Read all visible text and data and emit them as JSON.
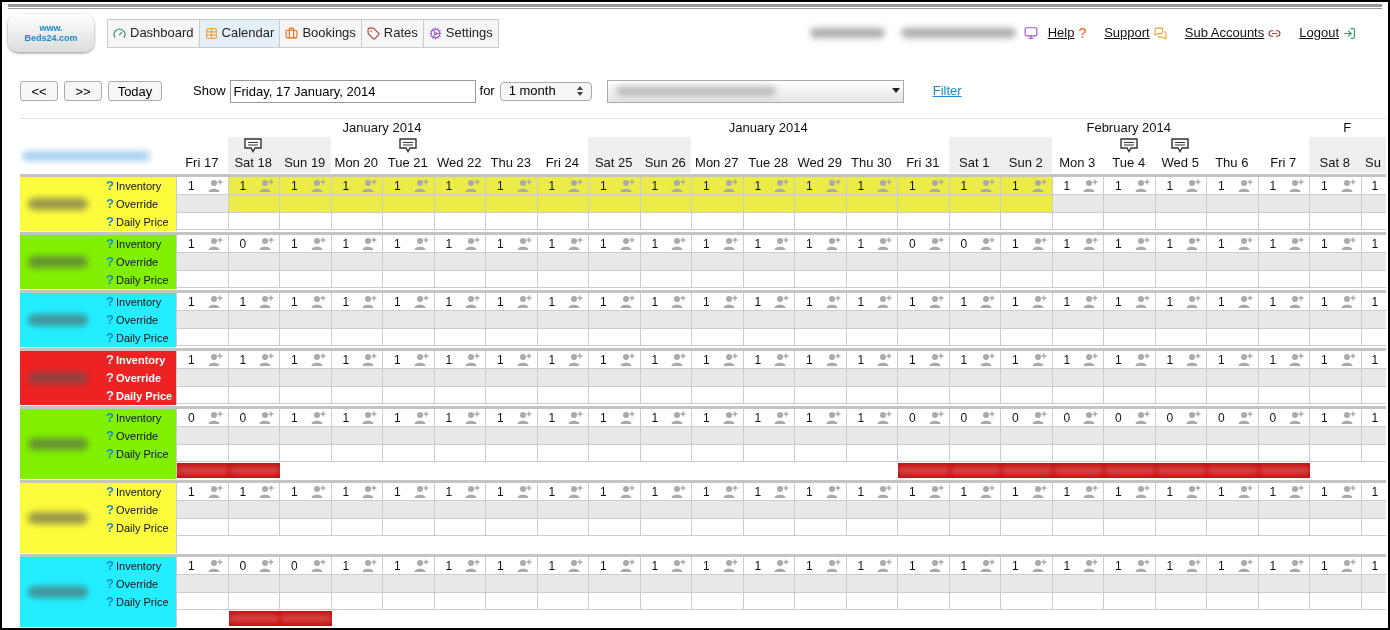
{
  "logo": {
    "line1": "www.",
    "line2": "Beds24.com"
  },
  "nav": [
    {
      "label": "Dashboard",
      "kind": "dashboard",
      "selected": false
    },
    {
      "label": "Calendar",
      "kind": "calendar",
      "selected": true
    },
    {
      "label": "Bookings",
      "kind": "bookings",
      "selected": false
    },
    {
      "label": "Rates",
      "kind": "rates",
      "selected": false
    },
    {
      "label": "Settings",
      "kind": "settings",
      "selected": false
    }
  ],
  "top_links": [
    {
      "label": "Help",
      "kind": "help",
      "mark": "?"
    },
    {
      "label": "Support",
      "kind": "support"
    },
    {
      "label": "Sub Accounts",
      "kind": "accounts"
    },
    {
      "label": "Logout",
      "kind": "logout"
    }
  ],
  "controls": {
    "prev": "<<",
    "next": ">>",
    "today": "Today",
    "show_label": "Show",
    "date": "Friday, 17 January, 2014",
    "for_label": "for",
    "period": "1 month",
    "filter": "Filter"
  },
  "months": [
    {
      "label": "January 2014",
      "days": [
        {
          "label": "Fri 17",
          "weekend": false,
          "comment": false
        },
        {
          "label": "Sat 18",
          "weekend": true,
          "comment": true
        },
        {
          "label": "Sun 19",
          "weekend": true,
          "comment": false
        },
        {
          "label": "Mon 20",
          "weekend": false,
          "comment": false
        },
        {
          "label": "Tue 21",
          "weekend": false,
          "comment": true
        },
        {
          "label": "Wed 22",
          "weekend": false,
          "comment": false
        },
        {
          "label": "Thu 23",
          "weekend": false,
          "comment": false
        },
        {
          "label": "Fri 24",
          "weekend": false,
          "comment": false
        }
      ]
    },
    {
      "label": "January 2014",
      "days": [
        {
          "label": "Sat 25",
          "weekend": true,
          "comment": false
        },
        {
          "label": "Sun 26",
          "weekend": true,
          "comment": false
        },
        {
          "label": "Mon 27",
          "weekend": false,
          "comment": false
        },
        {
          "label": "Tue 28",
          "weekend": false,
          "comment": false
        },
        {
          "label": "Wed 29",
          "weekend": false,
          "comment": false
        },
        {
          "label": "Thu 30",
          "weekend": false,
          "comment": false
        },
        {
          "label": "Fri 31",
          "weekend": false,
          "comment": false
        }
      ]
    },
    {
      "label": "February 2014",
      "days": [
        {
          "label": "Sat 1",
          "weekend": true,
          "comment": false
        },
        {
          "label": "Sun 2",
          "weekend": true,
          "comment": false
        },
        {
          "label": "Mon 3",
          "weekend": false,
          "comment": false
        },
        {
          "label": "Tue 4",
          "weekend": false,
          "comment": true
        },
        {
          "label": "Wed 5",
          "weekend": false,
          "comment": true
        },
        {
          "label": "Thu 6",
          "weekend": false,
          "comment": false
        },
        {
          "label": "Fri 7",
          "weekend": false,
          "comment": false
        }
      ]
    },
    {
      "label": "F",
      "days": [
        {
          "label": "Sat 8",
          "weekend": true,
          "comment": false
        },
        {
          "label": "Su",
          "weekend": true,
          "comment": false,
          "partial": true
        }
      ]
    }
  ],
  "rooms": [
    {
      "color": "#fcfc3c",
      "light_text": false,
      "labels": [
        {
          "mark": "?",
          "text": "Inventory"
        },
        {
          "mark": "?",
          "text": "Override"
        },
        {
          "mark": "?",
          "text": "Daily Price"
        }
      ],
      "cells": [
        {
          "value": "1",
          "selected": false
        },
        {
          "value": "1",
          "selected": true
        },
        {
          "value": "1",
          "selected": true
        },
        {
          "value": "1",
          "selected": true
        },
        {
          "value": "1",
          "selected": true
        },
        {
          "value": "1",
          "selected": true
        },
        {
          "value": "1",
          "selected": true
        },
        {
          "value": "1",
          "selected": true
        },
        {
          "value": "1",
          "selected": true
        },
        {
          "value": "1",
          "selected": true
        },
        {
          "value": "1",
          "selected": true
        },
        {
          "value": "1",
          "selected": true
        },
        {
          "value": "1",
          "selected": true
        },
        {
          "value": "1",
          "selected": true
        },
        {
          "value": "1",
          "selected": true
        },
        {
          "value": "1",
          "selected": true
        },
        {
          "value": "1",
          "selected": true
        },
        {
          "value": "1",
          "selected": false
        },
        {
          "value": "1",
          "selected": false
        },
        {
          "value": "1",
          "selected": false
        },
        {
          "value": "1",
          "selected": false
        },
        {
          "value": "1",
          "selected": false
        },
        {
          "value": "1",
          "selected": false
        },
        {
          "value": "1",
          "selected": false
        }
      ]
    },
    {
      "color": "#80f000",
      "light_text": false,
      "labels": [
        {
          "mark": "?",
          "text": "Inventory"
        },
        {
          "mark": "?",
          "text": "Override"
        },
        {
          "mark": "?",
          "text": "Daily Price"
        }
      ],
      "cells": [
        {
          "value": "1",
          "selected": false
        },
        {
          "value": "0",
          "selected": false
        },
        {
          "value": "1",
          "selected": false
        },
        {
          "value": "1",
          "selected": false
        },
        {
          "value": "1",
          "selected": false
        },
        {
          "value": "1",
          "selected": false
        },
        {
          "value": "1",
          "selected": false
        },
        {
          "value": "1",
          "selected": false
        },
        {
          "value": "1",
          "selected": false
        },
        {
          "value": "1",
          "selected": false
        },
        {
          "value": "1",
          "selected": false
        },
        {
          "value": "1",
          "selected": false
        },
        {
          "value": "1",
          "selected": false
        },
        {
          "value": "1",
          "selected": false
        },
        {
          "value": "0",
          "selected": false
        },
        {
          "value": "0",
          "selected": false
        },
        {
          "value": "1",
          "selected": false
        },
        {
          "value": "1",
          "selected": false
        },
        {
          "value": "1",
          "selected": false
        },
        {
          "value": "1",
          "selected": false
        },
        {
          "value": "1",
          "selected": false
        },
        {
          "value": "1",
          "selected": false
        },
        {
          "value": "1",
          "selected": false
        },
        {
          "value": "1",
          "selected": false
        }
      ]
    },
    {
      "color": "#22eeff",
      "light_text": false,
      "labels": [
        {
          "mark": "?",
          "text": "Inventory"
        },
        {
          "mark": "?",
          "text": "Override"
        },
        {
          "mark": "?",
          "text": "Daily Price"
        }
      ],
      "cells": [
        {
          "value": "1",
          "selected": false
        },
        {
          "value": "1",
          "selected": false
        },
        {
          "value": "1",
          "selected": false
        },
        {
          "value": "1",
          "selected": false
        },
        {
          "value": "1",
          "selected": false
        },
        {
          "value": "1",
          "selected": false
        },
        {
          "value": "1",
          "selected": false
        },
        {
          "value": "1",
          "selected": false
        },
        {
          "value": "1",
          "selected": false
        },
        {
          "value": "1",
          "selected": false
        },
        {
          "value": "1",
          "selected": false
        },
        {
          "value": "1",
          "selected": false
        },
        {
          "value": "1",
          "selected": false
        },
        {
          "value": "1",
          "selected": false
        },
        {
          "value": "1",
          "selected": false
        },
        {
          "value": "1",
          "selected": false
        },
        {
          "value": "1",
          "selected": false
        },
        {
          "value": "1",
          "selected": false
        },
        {
          "value": "1",
          "selected": false
        },
        {
          "value": "1",
          "selected": false
        },
        {
          "value": "1",
          "selected": false
        },
        {
          "value": "1",
          "selected": false
        },
        {
          "value": "1",
          "selected": false
        },
        {
          "value": "1",
          "selected": false
        }
      ]
    },
    {
      "color": "#ee2222",
      "light_text": true,
      "labels": [
        {
          "mark": "?",
          "text": "Inventory"
        },
        {
          "mark": "?",
          "text": "Override"
        },
        {
          "mark": "?",
          "text": "Daily Price"
        }
      ],
      "cells": [
        {
          "value": "1",
          "selected": false
        },
        {
          "value": "1",
          "selected": false
        },
        {
          "value": "1",
          "selected": false
        },
        {
          "value": "1",
          "selected": false
        },
        {
          "value": "1",
          "selected": false
        },
        {
          "value": "1",
          "selected": false
        },
        {
          "value": "1",
          "selected": false
        },
        {
          "value": "1",
          "selected": false
        },
        {
          "value": "1",
          "selected": false
        },
        {
          "value": "1",
          "selected": false
        },
        {
          "value": "1",
          "selected": false
        },
        {
          "value": "1",
          "selected": false
        },
        {
          "value": "1",
          "selected": false
        },
        {
          "value": "1",
          "selected": false
        },
        {
          "value": "1",
          "selected": false
        },
        {
          "value": "1",
          "selected": false
        },
        {
          "value": "1",
          "selected": false
        },
        {
          "value": "1",
          "selected": false
        },
        {
          "value": "1",
          "selected": false
        },
        {
          "value": "1",
          "selected": false
        },
        {
          "value": "1",
          "selected": false
        },
        {
          "value": "1",
          "selected": false
        },
        {
          "value": "1",
          "selected": false
        },
        {
          "value": "1",
          "selected": false
        }
      ]
    },
    {
      "color": "#80f000",
      "light_text": false,
      "labels": [
        {
          "mark": "?",
          "text": "Inventory"
        },
        {
          "mark": "?",
          "text": "Override"
        },
        {
          "mark": "?",
          "text": "Daily Price"
        }
      ],
      "cells": [
        {
          "value": "0",
          "selected": false,
          "booked": true
        },
        {
          "value": "0",
          "selected": false,
          "booked": true
        },
        {
          "value": "1",
          "selected": false,
          "booked": false
        },
        {
          "value": "1",
          "selected": false,
          "booked": false
        },
        {
          "value": "1",
          "selected": false,
          "booked": false
        },
        {
          "value": "1",
          "selected": false,
          "booked": false
        },
        {
          "value": "1",
          "selected": false,
          "booked": false
        },
        {
          "value": "1",
          "selected": false,
          "booked": false
        },
        {
          "value": "1",
          "selected": false,
          "booked": false
        },
        {
          "value": "1",
          "selected": false,
          "booked": false
        },
        {
          "value": "1",
          "selected": false,
          "booked": false
        },
        {
          "value": "1",
          "selected": false,
          "booked": false
        },
        {
          "value": "1",
          "selected": false,
          "booked": false
        },
        {
          "value": "1",
          "selected": false,
          "booked": false
        },
        {
          "value": "0",
          "selected": false,
          "booked": true
        },
        {
          "value": "0",
          "selected": false,
          "booked": true
        },
        {
          "value": "0",
          "selected": false,
          "booked": true
        },
        {
          "value": "0",
          "selected": false,
          "booked": true
        },
        {
          "value": "0",
          "selected": false,
          "booked": true
        },
        {
          "value": "0",
          "selected": false,
          "booked": true
        },
        {
          "value": "0",
          "selected": false,
          "booked": true
        },
        {
          "value": "0",
          "selected": false,
          "booked": true
        },
        {
          "value": "1",
          "selected": false,
          "booked": false
        },
        {
          "value": "1",
          "selected": false,
          "booked": false
        }
      ]
    },
    {
      "color": "#fcfc3c",
      "light_text": false,
      "labels": [
        {
          "mark": "?",
          "text": "Inventory"
        },
        {
          "mark": "?",
          "text": "Override"
        },
        {
          "mark": "?",
          "text": "Daily Price"
        }
      ],
      "cells": [
        {
          "value": "1",
          "selected": false,
          "booked": false
        },
        {
          "value": "1",
          "selected": false,
          "booked": false
        },
        {
          "value": "1",
          "selected": false,
          "booked": false
        },
        {
          "value": "1",
          "selected": false,
          "booked": false
        },
        {
          "value": "1",
          "selected": false,
          "booked": false
        },
        {
          "value": "1",
          "selected": false,
          "booked": false
        },
        {
          "value": "1",
          "selected": false,
          "booked": false
        },
        {
          "value": "1",
          "selected": false,
          "booked": false
        },
        {
          "value": "1",
          "selected": false,
          "booked": false
        },
        {
          "value": "1",
          "selected": false,
          "booked": false
        },
        {
          "value": "1",
          "selected": false,
          "booked": false
        },
        {
          "value": "1",
          "selected": false,
          "booked": false
        },
        {
          "value": "1",
          "selected": false,
          "booked": false
        },
        {
          "value": "1",
          "selected": false,
          "booked": false
        },
        {
          "value": "1",
          "selected": false,
          "booked": false
        },
        {
          "value": "1",
          "selected": false,
          "booked": false
        },
        {
          "value": "1",
          "selected": false,
          "booked": false
        },
        {
          "value": "1",
          "selected": false,
          "booked": false
        },
        {
          "value": "1",
          "selected": false,
          "booked": false
        },
        {
          "value": "1",
          "selected": false,
          "booked": false
        },
        {
          "value": "1",
          "selected": false,
          "booked": false
        },
        {
          "value": "1",
          "selected": false,
          "booked": false
        },
        {
          "value": "1",
          "selected": false,
          "booked": false
        },
        {
          "value": "1",
          "selected": false,
          "booked": false
        }
      ]
    },
    {
      "color": "#22eeff",
      "light_text": false,
      "labels": [
        {
          "mark": "?",
          "text": "Inventory"
        },
        {
          "mark": "?",
          "text": "Override"
        },
        {
          "mark": "?",
          "text": "Daily Price"
        }
      ],
      "cells": [
        {
          "value": "1",
          "selected": false,
          "booked": false
        },
        {
          "value": "0",
          "selected": false,
          "booked": true
        },
        {
          "value": "0",
          "selected": false,
          "booked": true
        },
        {
          "value": "1",
          "selected": false,
          "booked": false
        },
        {
          "value": "1",
          "selected": false,
          "booked": false
        },
        {
          "value": "1",
          "selected": false,
          "booked": false
        },
        {
          "value": "1",
          "selected": false,
          "booked": false
        },
        {
          "value": "1",
          "selected": false,
          "booked": false
        },
        {
          "value": "1",
          "selected": false,
          "booked": false
        },
        {
          "value": "1",
          "selected": false,
          "booked": false
        },
        {
          "value": "1",
          "selected": false,
          "booked": false
        },
        {
          "value": "1",
          "selected": false,
          "booked": false
        },
        {
          "value": "1",
          "selected": false,
          "booked": false
        },
        {
          "value": "1",
          "selected": false,
          "booked": false
        },
        {
          "value": "1",
          "selected": false,
          "booked": false
        },
        {
          "value": "1",
          "selected": false,
          "booked": false
        },
        {
          "value": "1",
          "selected": false,
          "booked": false
        },
        {
          "value": "1",
          "selected": false,
          "booked": false
        },
        {
          "value": "1",
          "selected": false,
          "booked": false
        },
        {
          "value": "1",
          "selected": false,
          "booked": false
        },
        {
          "value": "1",
          "selected": false,
          "booked": false
        },
        {
          "value": "1",
          "selected": false,
          "booked": false
        },
        {
          "value": "1",
          "selected": false,
          "booked": false
        },
        {
          "value": "1",
          "selected": false,
          "booked": false
        }
      ]
    }
  ]
}
